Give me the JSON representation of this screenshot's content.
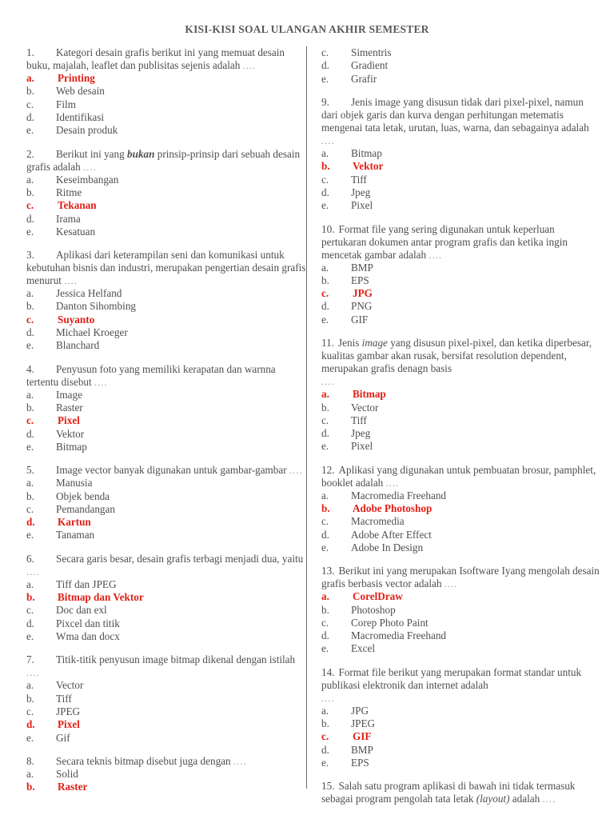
{
  "document": {
    "title": "KISI-KISI SOAL ULANGAN AKHIR SEMESTER",
    "answer_color": "#e01f16",
    "text_color": "#4f4f4f",
    "divider_color": "#6b6b6b",
    "background_color": "#ffffff",
    "ellipsis": "...."
  },
  "left_column": {
    "questions": [
      {
        "number": "1.",
        "stem_parts": [
          {
            "text": "Kategori desain grafis berikut ini yang memuat desain buku, majalah, leaflet dan publisitas sejenis adalah ",
            "style": "normal"
          }
        ],
        "options": [
          {
            "letter": "a.",
            "text": "Printing",
            "answer": true
          },
          {
            "letter": "b.",
            "text": "Web desain",
            "answer": false
          },
          {
            "letter": "c.",
            "text": "Film",
            "answer": false
          },
          {
            "letter": "d.",
            "text": "Identifikasi",
            "answer": false
          },
          {
            "letter": "e.",
            "text": "Desain produk",
            "answer": false
          }
        ]
      },
      {
        "number": "2.",
        "stem_parts": [
          {
            "text": "Berikut ini yang ",
            "style": "normal"
          },
          {
            "text": "bukan",
            "style": "boldital"
          },
          {
            "text": " prinsip-prinsip dari sebuah desain grafis adalah ",
            "style": "normal"
          }
        ],
        "options": [
          {
            "letter": "a.",
            "text": "Keseimbangan",
            "answer": false
          },
          {
            "letter": "b.",
            "text": "Ritme",
            "answer": false
          },
          {
            "letter": "c.",
            "text": "Tekanan",
            "answer": true
          },
          {
            "letter": "d.",
            "text": "Irama",
            "answer": false
          },
          {
            "letter": "e.",
            "text": "Kesatuan",
            "answer": false
          }
        ]
      },
      {
        "number": "3.",
        "stem_parts": [
          {
            "text": "Aplikasi dari keterampilan seni dan komunikasi untuk kebutuhan bisnis dan industri, merupakan pengertian desain grafis menurut ",
            "style": "normal"
          }
        ],
        "options": [
          {
            "letter": "a.",
            "text": "Jessica Helfand",
            "answer": false
          },
          {
            "letter": "b.",
            "text": "Danton Sihombing",
            "answer": false
          },
          {
            "letter": "c.",
            "text": "Suyanto",
            "answer": true
          },
          {
            "letter": "d.",
            "text": "Michael Kroeger",
            "answer": false
          },
          {
            "letter": "e.",
            "text": "Blanchard",
            "answer": false
          }
        ]
      },
      {
        "number": "4.",
        "stem_parts": [
          {
            "text": "Penyusun foto yang memiliki kerapatan dan warnna tertentu disebut ",
            "style": "normal"
          }
        ],
        "options": [
          {
            "letter": "a.",
            "text": "Image",
            "answer": false
          },
          {
            "letter": "b.",
            "text": "Raster",
            "answer": false
          },
          {
            "letter": "c.",
            "text": "Pixel",
            "answer": true
          },
          {
            "letter": "d.",
            "text": "Vektor",
            "answer": false
          },
          {
            "letter": "e.",
            "text": "Bitmap",
            "answer": false
          }
        ]
      },
      {
        "number": "5.",
        "stem_parts": [
          {
            "text": "Image vector banyak digunakan untuk gambar-gambar ",
            "style": "normal"
          }
        ],
        "options": [
          {
            "letter": "a.",
            "text": "Manusia",
            "answer": false
          },
          {
            "letter": "b.",
            "text": "Objek benda",
            "answer": false
          },
          {
            "letter": "c.",
            "text": "Pemandangan",
            "answer": false
          },
          {
            "letter": "d.",
            "text": "Kartun",
            "answer": true
          },
          {
            "letter": "e.",
            "text": "Tanaman",
            "answer": false
          }
        ]
      },
      {
        "number": "6.",
        "stem_parts": [
          {
            "text": "Secara garis besar, desain grafis terbagi menjadi dua, yaitu ",
            "style": "normal"
          }
        ],
        "options": [
          {
            "letter": "a.",
            "text": "Tiff dan JPEG",
            "answer": false
          },
          {
            "letter": "b.",
            "text": "Bitmap dan Vektor",
            "answer": true
          },
          {
            "letter": "c.",
            "text": "Doc dan exl",
            "answer": false
          },
          {
            "letter": "d.",
            "text": "Pixcel dan titik",
            "answer": false
          },
          {
            "letter": "e.",
            "text": "Wma dan docx",
            "answer": false
          }
        ]
      },
      {
        "number": "7.",
        "stem_parts": [
          {
            "text": "Titik-titik penyusun image bitmap dikenal dengan istilah ",
            "style": "normal"
          }
        ],
        "options": [
          {
            "letter": "a.",
            "text": "Vector",
            "answer": false
          },
          {
            "letter": "b.",
            "text": "Tiff",
            "answer": false
          },
          {
            "letter": "c.",
            "text": "JPEG",
            "answer": false
          },
          {
            "letter": "d.",
            "text": "Pixel",
            "answer": true
          },
          {
            "letter": "e.",
            "text": "Gif",
            "answer": false
          }
        ]
      },
      {
        "number": "8.",
        "stem_parts": [
          {
            "text": "Secara teknis bitmap disebut juga dengan ",
            "style": "normal"
          }
        ],
        "options": [
          {
            "letter": "a.",
            "text": "Solid",
            "answer": false
          },
          {
            "letter": "b.",
            "text": "Raster",
            "answer": true
          }
        ]
      }
    ]
  },
  "right_column": {
    "continued_options": [
      {
        "letter": "c.",
        "text": "Simentris",
        "answer": false
      },
      {
        "letter": "d.",
        "text": "Gradient",
        "answer": false
      },
      {
        "letter": "e.",
        "text": "Grafir",
        "answer": false
      }
    ],
    "questions": [
      {
        "number": "9.",
        "wide": false,
        "stem_parts": [
          {
            "text": "Jenis image yang disusun tidak dari pixel-pixel, namun dari objek garis dan kurva dengan perhitungan metematis mengenai tata letak, urutan, luas, warna, dan sebagainya adalah ",
            "style": "normal"
          }
        ],
        "options": [
          {
            "letter": "a.",
            "text": "Bitmap",
            "answer": false
          },
          {
            "letter": "b.",
            "text": "Vektor",
            "answer": true
          },
          {
            "letter": "c.",
            "text": "Tiff",
            "answer": false
          },
          {
            "letter": "d.",
            "text": "Jpeg",
            "answer": false
          },
          {
            "letter": "e.",
            "text": "Pixel",
            "answer": false
          }
        ]
      },
      {
        "number": "10.",
        "wide": true,
        "stem_parts": [
          {
            "text": "Format file yang sering digunakan untuk keperluan pertukaran dokumen antar program grafis dan ketika ingin mencetak gambar adalah ",
            "style": "normal"
          }
        ],
        "options": [
          {
            "letter": "a.",
            "text": "BMP",
            "answer": false
          },
          {
            "letter": "b.",
            "text": "EPS",
            "answer": false
          },
          {
            "letter": "c.",
            "text": "JPG",
            "answer": true
          },
          {
            "letter": "d.",
            "text": "PNG",
            "answer": false
          },
          {
            "letter": "e.",
            "text": "GIF",
            "answer": false
          }
        ]
      },
      {
        "number": "11.",
        "wide": true,
        "stem_parts": [
          {
            "text": "Jenis ",
            "style": "normal"
          },
          {
            "text": "image",
            "style": "ital"
          },
          {
            "text": " yang disusun pixel-pixel, dan ketika diperbesar, kualitas gambar akan rusak, bersifat resolution dependent, merupakan grafis denagn basis",
            "style": "normal"
          }
        ],
        "stem_trailing_ellipsis_own_line": true,
        "options": [
          {
            "letter": "a.",
            "text": "Bitmap",
            "answer": true
          },
          {
            "letter": "b.",
            "text": "Vector",
            "answer": false
          },
          {
            "letter": "c.",
            "text": "Tiff",
            "answer": false
          },
          {
            "letter": "d.",
            "text": "Jpeg",
            "answer": false
          },
          {
            "letter": "e.",
            "text": "Pixel",
            "answer": false
          }
        ]
      },
      {
        "number": "12.",
        "wide": true,
        "stem_parts": [
          {
            "text": "Aplikasi yang digunakan untuk pembuatan brosur, pamphlet, booklet adalah ",
            "style": "normal"
          }
        ],
        "options": [
          {
            "letter": "a.",
            "text": "Macromedia Freehand",
            "answer": false
          },
          {
            "letter": "b.",
            "text": "Adobe Photoshop",
            "answer": true
          },
          {
            "letter": "c.",
            "text": "Macromedia",
            "answer": false
          },
          {
            "letter": "d.",
            "text": "Adobe After Effect",
            "answer": false
          },
          {
            "letter": "e.",
            "text": "Adobe In Design",
            "answer": false
          }
        ]
      },
      {
        "number": "13.",
        "wide": true,
        "stem_parts": [
          {
            "text": "Berikut ini yang merupakan Isoftware Iyang mengolah desain grafis berbasis vector adalah ",
            "style": "normal"
          }
        ],
        "options": [
          {
            "letter": "a.",
            "text": "CorelDraw",
            "answer": true
          },
          {
            "letter": "b.",
            "text": "Photoshop",
            "answer": false
          },
          {
            "letter": "c.",
            "text": "Corep Photo Paint",
            "answer": false
          },
          {
            "letter": "d.",
            "text": "Macromedia Freehand",
            "answer": false
          },
          {
            "letter": "e.",
            "text": "Excel",
            "answer": false
          }
        ]
      },
      {
        "number": "14.",
        "wide": true,
        "stem_parts": [
          {
            "text": "Format file berikut yang merupakan format standar untuk publikasi elektronik dan internet adalah",
            "style": "normal"
          }
        ],
        "stem_trailing_ellipsis_own_line": true,
        "options": [
          {
            "letter": "a.",
            "text": "JPG",
            "answer": false
          },
          {
            "letter": "b.",
            "text": "JPEG",
            "answer": false
          },
          {
            "letter": "c.",
            "text": "GIF",
            "answer": true
          },
          {
            "letter": "d.",
            "text": "BMP",
            "answer": false
          },
          {
            "letter": "e.",
            "text": "EPS",
            "answer": false
          }
        ]
      },
      {
        "number": "15.",
        "wide": true,
        "stem_parts": [
          {
            "text": "Salah satu program aplikasi di bawah ini tidak termasuk sebagai program pengolah tata letak ",
            "style": "normal"
          },
          {
            "text": "(layout)",
            "style": "ital"
          },
          {
            "text": " adalah ",
            "style": "normal"
          }
        ],
        "options": []
      }
    ]
  }
}
